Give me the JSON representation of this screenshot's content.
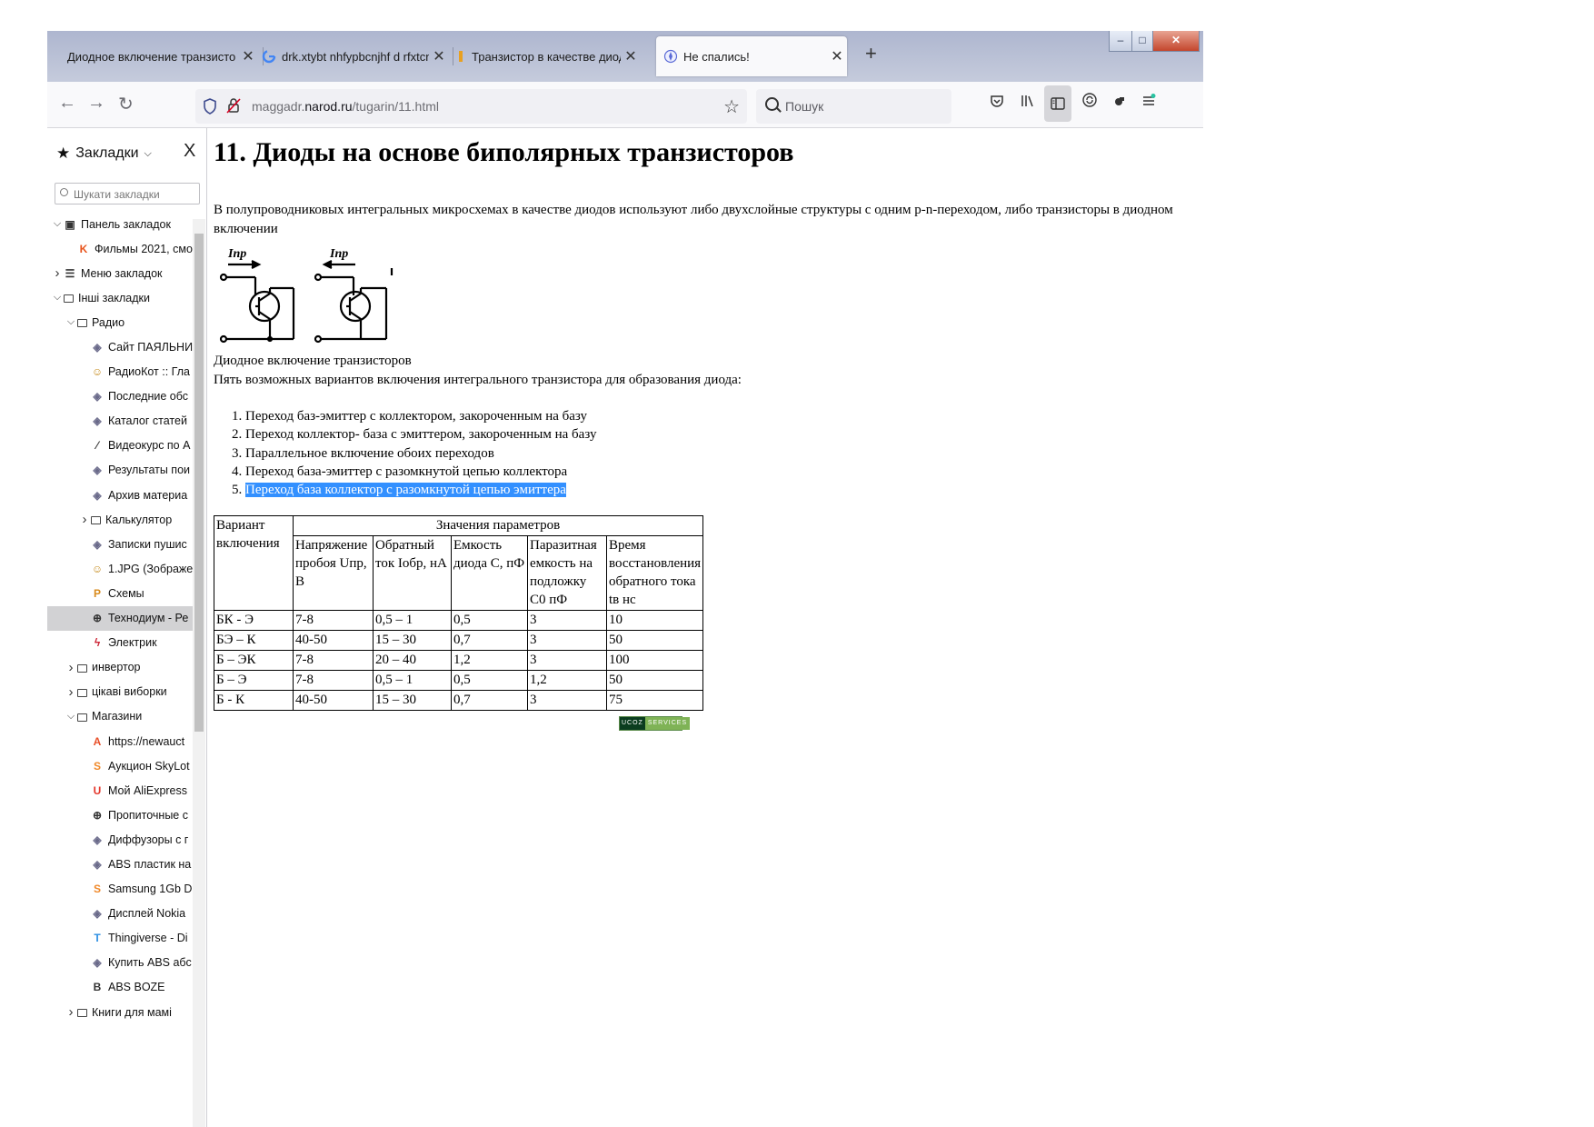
{
  "browser": {
    "tabs": [
      {
        "label": "Диодное включение транзисто",
        "icon": "page-icon"
      },
      {
        "label": "drk.xtybt nhfypbcnjhf d rfxtcnd",
        "icon": "google-icon"
      },
      {
        "label": "Транзистор в качестве диода",
        "icon": "page-icon"
      },
      {
        "label": "Не спались!",
        "icon": "site-icon",
        "active": true
      }
    ],
    "new_tab": "+",
    "window_controls": {
      "minimize": "–",
      "maximize": "□",
      "close": "✕"
    },
    "url_host_prefix": "maggadr.",
    "url_domain": "narod.ru",
    "url_path": "/tugarin/11.html",
    "search_placeholder": "Пошук"
  },
  "sidebar": {
    "title": "Закладки",
    "close": "X",
    "search_placeholder": "Шукати закладки",
    "items": [
      {
        "label": "Панель закладок",
        "twisty": "open",
        "icon": "bookmarks-toolbar-icon",
        "level": 0
      },
      {
        "label": "Фильмы 2021, смо",
        "icon": "kinopoisk-icon",
        "level": 1
      },
      {
        "label": "Меню закладок",
        "twisty": "closed",
        "icon": "menu-icon",
        "level": 0
      },
      {
        "label": "Інші закладки",
        "twisty": "open",
        "icon": "folder-icon",
        "level": 0
      },
      {
        "label": "Радио",
        "twisty": "open",
        "icon": "folder-icon",
        "level": 1
      },
      {
        "label": "Сайт ПАЯЛЬНИК",
        "icon": "site-icon",
        "level": 2
      },
      {
        "label": "РадиоКот :: Гла",
        "icon": "cat-icon",
        "level": 2
      },
      {
        "label": "Последние обс",
        "icon": "site-icon",
        "level": 2
      },
      {
        "label": "Каталог статей",
        "icon": "site-icon",
        "level": 2
      },
      {
        "label": "Видеокурс по А",
        "icon": "pencil-icon",
        "level": 2
      },
      {
        "label": "Результаты пои",
        "icon": "site-icon",
        "level": 2
      },
      {
        "label": "Архив материа",
        "icon": "site-icon",
        "level": 2
      },
      {
        "label": "Калькулятор",
        "twisty": "closed",
        "icon": "folder-icon",
        "level": 2
      },
      {
        "label": "Записки пушис",
        "icon": "site-icon",
        "level": 2
      },
      {
        "label": "1.JPG (Зображе",
        "icon": "cat-icon",
        "level": 2
      },
      {
        "label": "Схемы",
        "icon": "pa-icon",
        "level": 2
      },
      {
        "label": "Технодиум - Ре",
        "icon": "globe-icon",
        "level": 2,
        "selected": true
      },
      {
        "label": "Электрик",
        "icon": "bolt-icon",
        "level": 2
      },
      {
        "label": "инвертор",
        "twisty": "closed",
        "icon": "folder-icon",
        "level": 1
      },
      {
        "label": "цікаві виборки",
        "twisty": "closed",
        "icon": "folder-icon",
        "level": 1
      },
      {
        "label": "Магазини",
        "twisty": "open",
        "icon": "folder-icon",
        "level": 1
      },
      {
        "label": "https://newauct",
        "icon": "a-icon",
        "level": 2
      },
      {
        "label": "Аукцион SkyLot",
        "icon": "s-icon",
        "level": 2
      },
      {
        "label": "Мой AliExpress",
        "icon": "aliexpress-icon",
        "level": 2
      },
      {
        "label": "Пропиточные с",
        "icon": "globe-icon",
        "level": 2
      },
      {
        "label": "Диффузоры с г",
        "icon": "site-icon",
        "level": 2
      },
      {
        "label": "ABS пластик на",
        "icon": "site-icon",
        "level": 2
      },
      {
        "label": "Samsung 1Gb D",
        "icon": "s-icon",
        "level": 2
      },
      {
        "label": "Дисплей Nokia",
        "icon": "site-icon",
        "level": 2
      },
      {
        "label": "Thingiverse - Di",
        "icon": "thingiverse-icon",
        "level": 2
      },
      {
        "label": "Купить ABS абс",
        "icon": "site-icon",
        "level": 2
      },
      {
        "label": "ABS BOZE",
        "icon": "b-icon",
        "level": 2
      },
      {
        "label": "Книги для мамі",
        "twisty": "closed",
        "icon": "folder-icon",
        "level": 1
      }
    ]
  },
  "page": {
    "title": "11. Диоды на основе биполярных транзисторов",
    "intro": "В полупроводниковых интегральных микросхемах  в качестве диодов используют либо двухслойные структуры с одним p-n-переходом, либо транзисторы в диодном включении",
    "schematic_label": "Iпр",
    "caption": "Диодное   включение транзисторов",
    "list_intro": "Пять возможных вариантов включения интегрального транзистора для образования диода:",
    "list": [
      "Переход баз-эмиттер с коллектором, закороченным на базу",
      "Переход коллектор- база с эмиттером, закороченным на базу",
      "Параллельное включение обоих переходов",
      "Переход база-эмиттер с разомкнутой цепью коллектора",
      "Переход база коллектор с разомкнутой цепью эмиттера"
    ],
    "table": {
      "corner": "Вариант включения",
      "group_header": "Значения параметров",
      "headers": [
        "Напряжение пробоя Uпр, В",
        "Обратный ток Iобр, нА",
        "Емкость диода С, пФ",
        "Паразитная емкость на подложку С0 пФ",
        "Время восстановления обратного тока tв нс"
      ],
      "rows": [
        [
          "БК - Э",
          "7-8",
          "0,5 – 1",
          "0,5",
          "3",
          "10"
        ],
        [
          "БЭ – К",
          "40-50",
          "15 – 30",
          "0,7",
          "3",
          "50"
        ],
        [
          "Б – ЭК",
          "7-8",
          "20 – 40",
          "1,2",
          "3",
          "100"
        ],
        [
          "Б – Э",
          "7-8",
          "0,5 – 1",
          "0,5",
          "1,2",
          "50"
        ],
        [
          "Б - К",
          "40-50",
          "15 – 30",
          "0,7",
          "3",
          "75"
        ]
      ]
    },
    "badge": {
      "left": "UCOZ",
      "right": "SERVICES"
    }
  }
}
